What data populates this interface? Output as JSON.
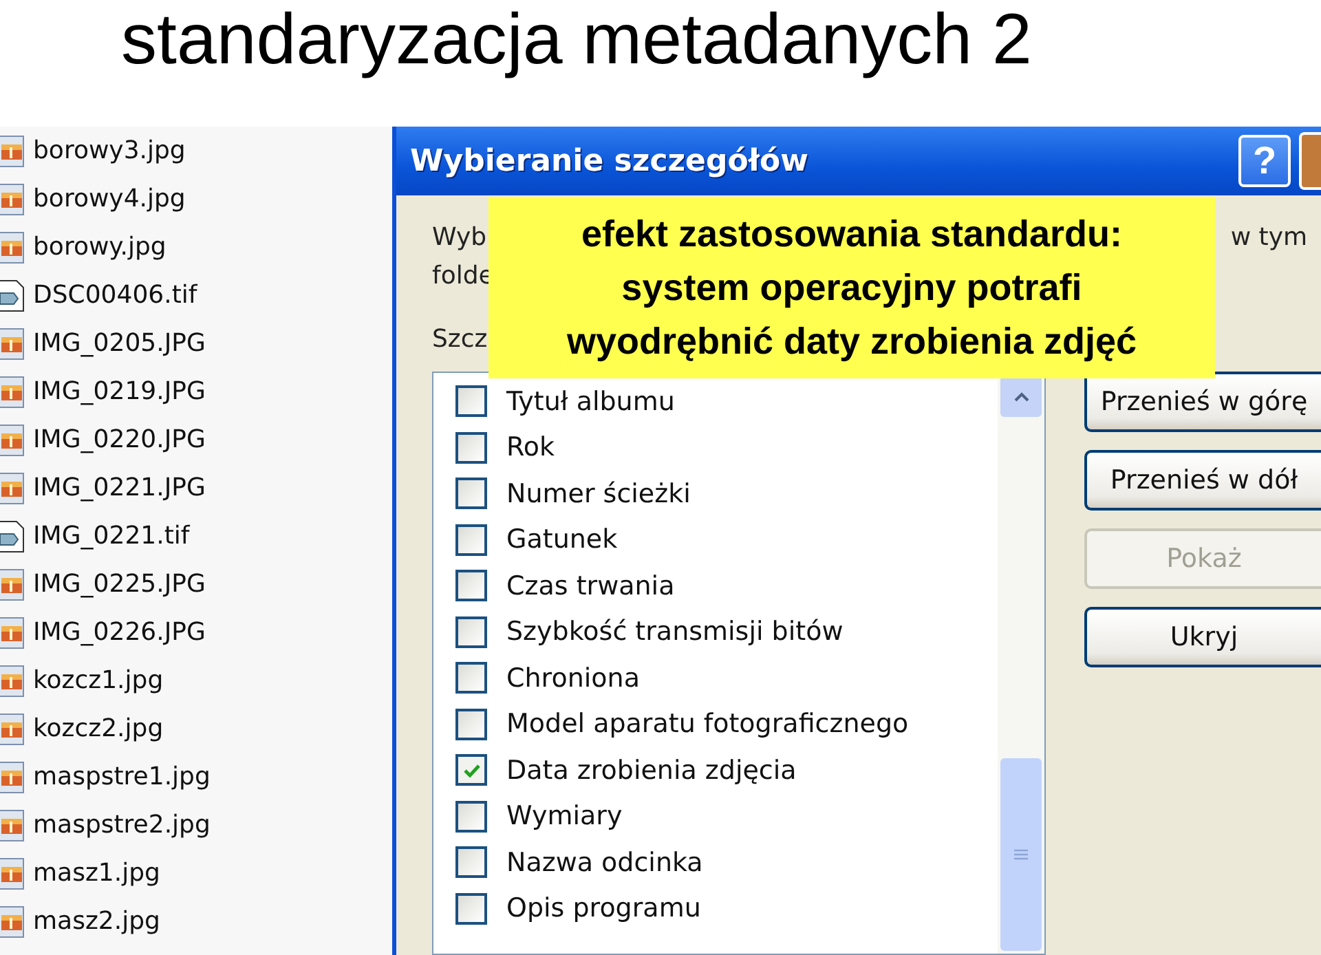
{
  "slide": {
    "title": "standaryzacja metadanych 2"
  },
  "files": [
    {
      "name": "borowy3.jpg",
      "kind": "image"
    },
    {
      "name": "borowy4.jpg",
      "kind": "image"
    },
    {
      "name": "borowy.jpg",
      "kind": "image"
    },
    {
      "name": "DSC00406.tif",
      "kind": "tiff"
    },
    {
      "name": "IMG_0205.JPG",
      "kind": "image"
    },
    {
      "name": "IMG_0219.JPG",
      "kind": "image"
    },
    {
      "name": "IMG_0220.JPG",
      "kind": "image"
    },
    {
      "name": "IMG_0221.JPG",
      "kind": "image"
    },
    {
      "name": "IMG_0221.tif",
      "kind": "tiff"
    },
    {
      "name": "IMG_0225.JPG",
      "kind": "image"
    },
    {
      "name": "IMG_0226.JPG",
      "kind": "image"
    },
    {
      "name": "kozcz1.jpg",
      "kind": "image"
    },
    {
      "name": "kozcz2.jpg",
      "kind": "image"
    },
    {
      "name": "maspstre1.jpg",
      "kind": "image"
    },
    {
      "name": "maspstre2.jpg",
      "kind": "image"
    },
    {
      "name": "masz1.jpg",
      "kind": "image"
    },
    {
      "name": "masz2.jpg",
      "kind": "image"
    }
  ],
  "dialog": {
    "title": "Wybieranie szczegółów",
    "help": "?",
    "intro_fragments": [
      "Wyb",
      "w tym",
      "folde"
    ],
    "details_label": "Szcz",
    "details": [
      {
        "label": "Tytuł albumu",
        "checked": false
      },
      {
        "label": "Rok",
        "checked": false
      },
      {
        "label": "Numer ścieżki",
        "checked": false
      },
      {
        "label": "Gatunek",
        "checked": false
      },
      {
        "label": "Czas trwania",
        "checked": false
      },
      {
        "label": "Szybkość transmisji bitów",
        "checked": false
      },
      {
        "label": "Chroniona",
        "checked": false
      },
      {
        "label": "Model aparatu fotograficznego",
        "checked": false
      },
      {
        "label": "Data zrobienia zdjęcia",
        "checked": true
      },
      {
        "label": "Wymiary",
        "checked": false
      },
      {
        "label": "Nazwa odcinka",
        "checked": false
      },
      {
        "label": "Opis programu",
        "checked": false
      }
    ],
    "buttons": [
      {
        "label": "Przenieś w górę",
        "disabled": false
      },
      {
        "label": "Przenieś w dół",
        "disabled": false
      },
      {
        "label": "Pokaż",
        "disabled": true
      },
      {
        "label": "Ukryj",
        "disabled": false
      }
    ]
  },
  "callout": {
    "lines": [
      "efekt zastosowania standardu:",
      "system operacyjny potrafi",
      "wyodrębnić daty zrobienia zdjęć"
    ]
  }
}
